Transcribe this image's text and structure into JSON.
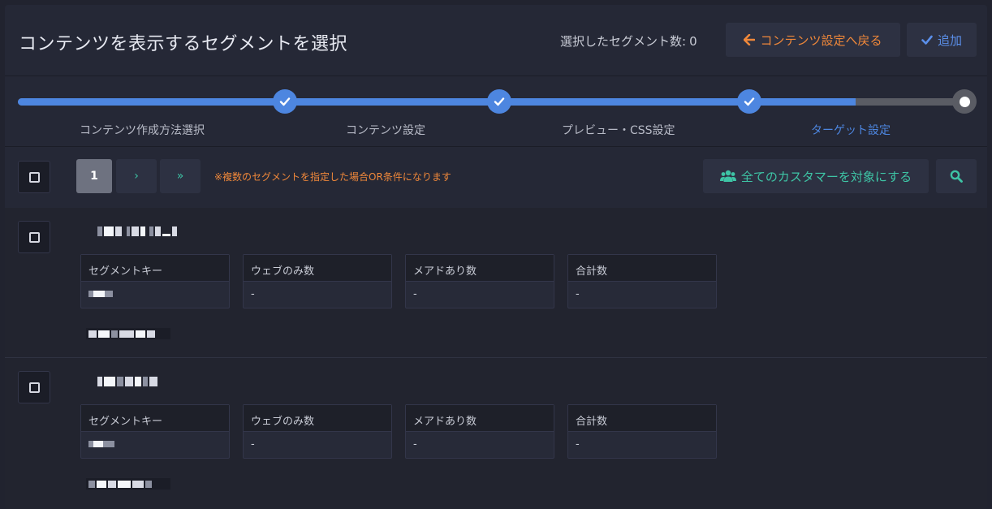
{
  "header": {
    "title": "コンテンツを表示するセグメントを選択",
    "selected_count_label": "選択したセグメント数:",
    "selected_count": "0",
    "back_button": "コンテンツ設定へ戻る",
    "add_button": "追加"
  },
  "stepper": {
    "progress_percent": 88,
    "steps": [
      {
        "label": "コンテンツ作成方法選択",
        "state": "done"
      },
      {
        "label": "コンテンツ設定",
        "state": "done"
      },
      {
        "label": "プレビュー・CSS設定",
        "state": "done"
      },
      {
        "label": "ターゲット設定",
        "state": "current"
      }
    ]
  },
  "toolbar": {
    "pagination": {
      "current_page": "1",
      "next": "›",
      "last": "»"
    },
    "note": "※複数のセグメントを指定した場合OR条件になります",
    "all_customers_button": "全てのカスタマーを対象にする"
  },
  "segments": {
    "columns": [
      "セグメントキー",
      "ウェブのみ数",
      "メアドあり数",
      "合計数"
    ],
    "rows": [
      {
        "web_only": "-",
        "with_email": "-",
        "total": "-"
      },
      {
        "web_only": "-",
        "with_email": "-",
        "total": "-"
      }
    ]
  },
  "colors": {
    "accent_blue": "#4d86e0",
    "accent_orange": "#f0883a",
    "accent_teal": "#3ec4a5",
    "background": "#252836"
  },
  "icons": [
    "arrow-left-icon",
    "check-icon",
    "users-icon",
    "search-icon",
    "checkbox-icon"
  ]
}
